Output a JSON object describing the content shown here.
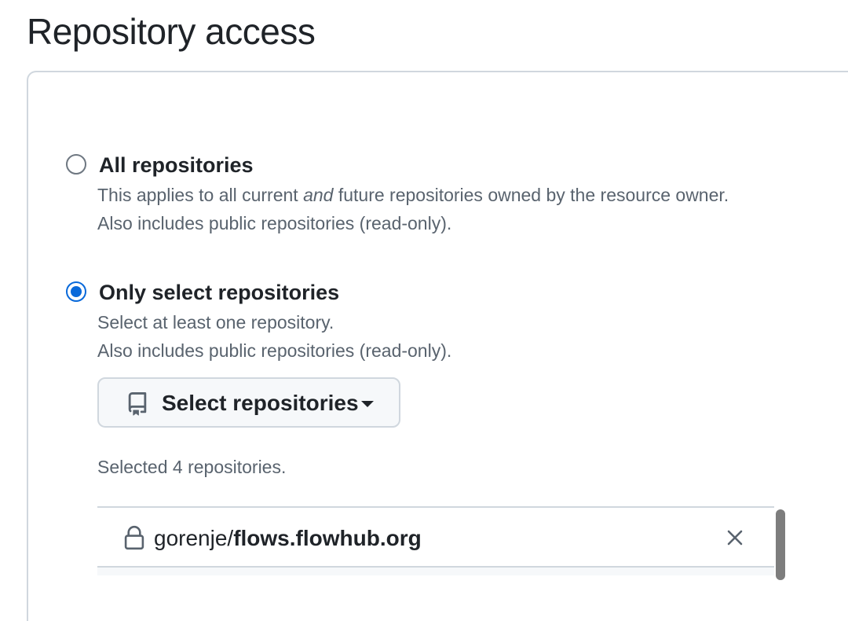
{
  "page": {
    "title": "Repository access"
  },
  "options": {
    "all": {
      "label": "All repositories",
      "desc_before": "This applies to all current ",
      "desc_em": "and",
      "desc_after": " future repositories owned by the resource owner.",
      "desc_line2": "Also includes public repositories (read-only).",
      "checked": false
    },
    "select": {
      "label": "Only select repositories",
      "desc_line1": "Select at least one repository.",
      "desc_line2": "Also includes public repositories (read-only).",
      "checked": true
    }
  },
  "select_button": {
    "label": "Select repositories",
    "icon": "repo-icon"
  },
  "selected_summary": "Selected 4 repositories.",
  "repositories": [
    {
      "owner": "gorenje/",
      "name": "flows.flowhub.org",
      "icon": "lock-icon"
    }
  ],
  "colors": {
    "accent": "#0969da",
    "border": "#d0d7de",
    "muted_text": "#59636e"
  }
}
